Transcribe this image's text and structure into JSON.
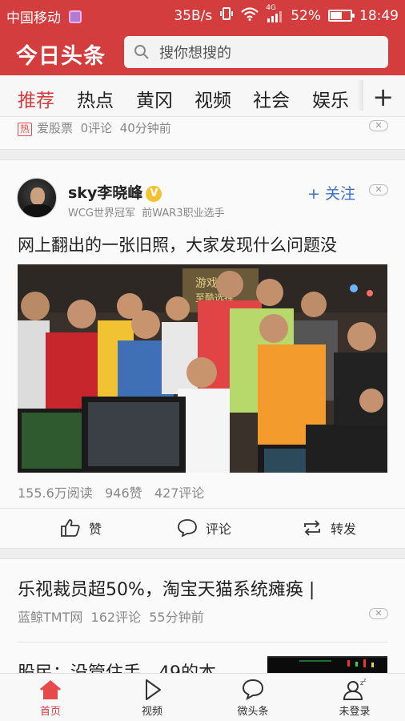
{
  "status_bar": {
    "carrier": "中国移动",
    "speed": "35B/s",
    "network": "4G",
    "battery": "52%",
    "time": "18:49"
  },
  "header": {
    "logo": "今日头条",
    "search_placeholder": "搜你想搜的"
  },
  "tabs": [
    "推荐",
    "热点",
    "黄冈",
    "视频",
    "社会",
    "娱乐"
  ],
  "tab_add": "+",
  "prev_item": {
    "tag": "热",
    "source": "爱股票",
    "comments": "0评论",
    "time": "40分钟前"
  },
  "post": {
    "author": "sky李晓峰",
    "author_desc": "WCG世界冠军  前WAR3职业选手",
    "follow_label": "+ 关注",
    "title": "网上翻出的一张旧照，大家发现什么问题没",
    "stats": {
      "reads": "155.6万阅读",
      "likes": "946赞",
      "comments": "427评论"
    },
    "actions": {
      "like": "赞",
      "comment": "评论",
      "share": "转发"
    }
  },
  "news2": {
    "title": "乐视裁员超50%，淘宝天猫系统瘫痪 |",
    "source": "蓝鲸TMT网",
    "comments": "162评论",
    "time": "55分钟前"
  },
  "news3": {
    "title_partial": "股民：没管住手，49的本"
  },
  "bottom_nav": {
    "home": "首页",
    "video": "视频",
    "micro": "微头条",
    "login": "未登录"
  },
  "colors": {
    "brand_red": "#d43d3d",
    "accent_blue": "#3a6fc4"
  }
}
